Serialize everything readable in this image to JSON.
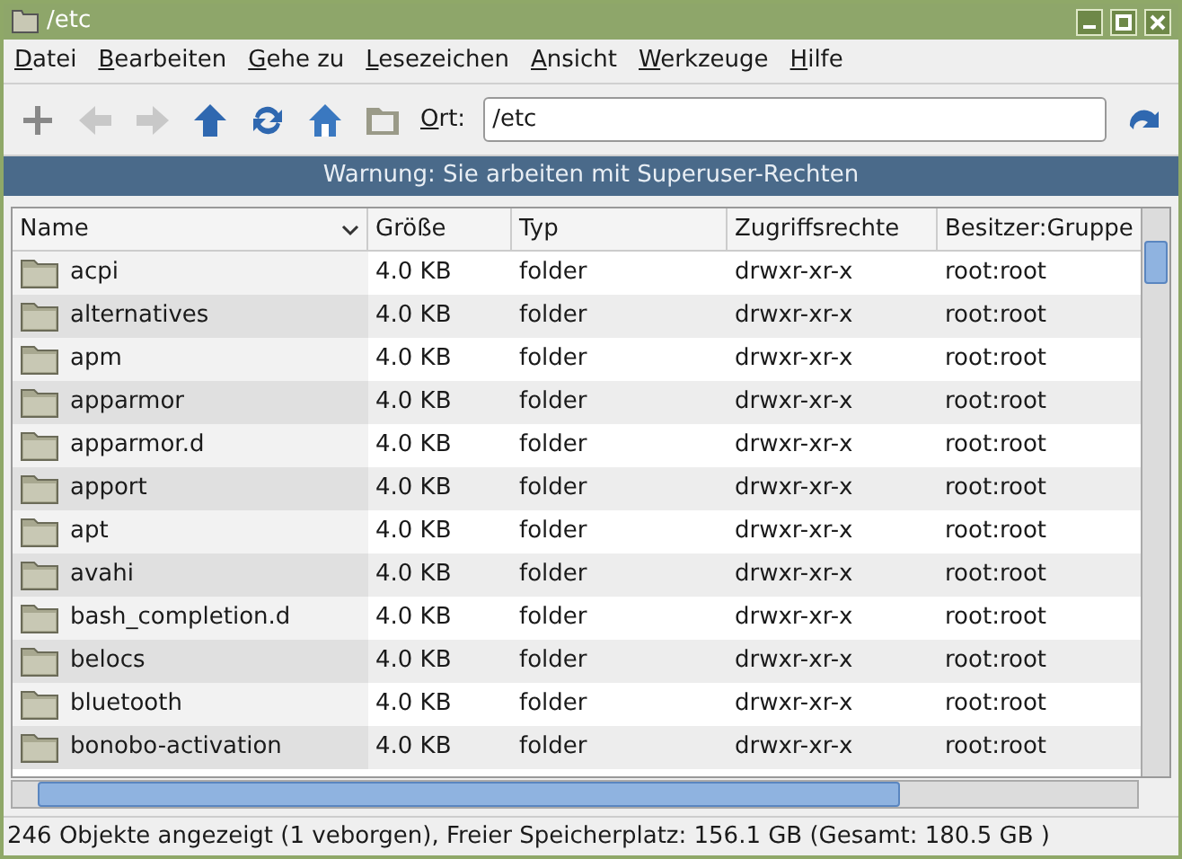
{
  "window": {
    "title": "/etc"
  },
  "menu": [
    "Datei",
    "Bearbeiten",
    "Gehe zu",
    "Lesezeichen",
    "Ansicht",
    "Werkzeuge",
    "Hilfe"
  ],
  "toolbar": {
    "location_label": "Ort:",
    "location_value": "/etc"
  },
  "warning": "Warnung: Sie arbeiten mit Superuser-Rechten",
  "table": {
    "columns": [
      "Name",
      "Größe",
      "Typ",
      "Zugriffsrechte",
      "Besitzer:Gruppe"
    ],
    "rows": [
      [
        "acpi",
        "4.0 KB",
        "folder",
        "drwxr-xr-x",
        "root:root"
      ],
      [
        "alternatives",
        "4.0 KB",
        "folder",
        "drwxr-xr-x",
        "root:root"
      ],
      [
        "apm",
        "4.0 KB",
        "folder",
        "drwxr-xr-x",
        "root:root"
      ],
      [
        "apparmor",
        "4.0 KB",
        "folder",
        "drwxr-xr-x",
        "root:root"
      ],
      [
        "apparmor.d",
        "4.0 KB",
        "folder",
        "drwxr-xr-x",
        "root:root"
      ],
      [
        "apport",
        "4.0 KB",
        "folder",
        "drwxr-xr-x",
        "root:root"
      ],
      [
        "apt",
        "4.0 KB",
        "folder",
        "drwxr-xr-x",
        "root:root"
      ],
      [
        "avahi",
        "4.0 KB",
        "folder",
        "drwxr-xr-x",
        "root:root"
      ],
      [
        "bash_completion.d",
        "4.0 KB",
        "folder",
        "drwxr-xr-x",
        "root:root"
      ],
      [
        "belocs",
        "4.0 KB",
        "folder",
        "drwxr-xr-x",
        "root:root"
      ],
      [
        "bluetooth",
        "4.0 KB",
        "folder",
        "drwxr-xr-x",
        "root:root"
      ],
      [
        "bonobo-activation",
        "4.0 KB",
        "folder",
        "drwxr-xr-x",
        "root:root"
      ]
    ]
  },
  "status_bar": "246 Objekte angezeigt (1 veborgen), Freier Speicherplatz: 156.1 GB (Gesamt: 180.5 GB )"
}
